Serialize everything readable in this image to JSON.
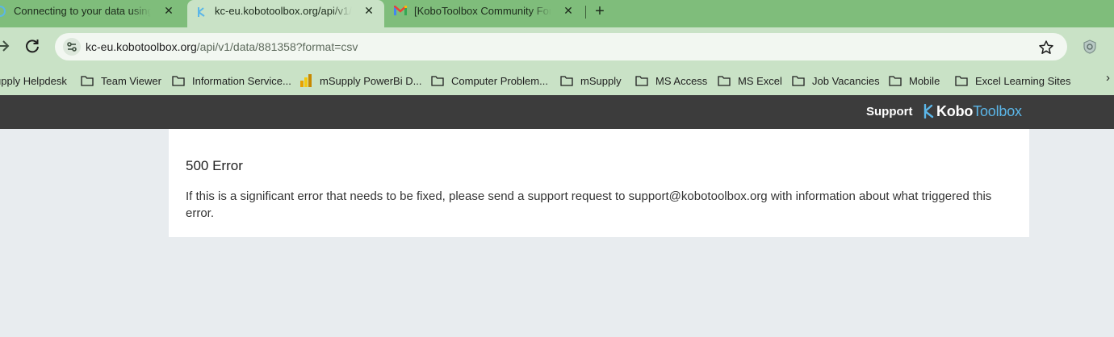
{
  "tabs": [
    {
      "title": "Connecting to your data using",
      "close": "✕"
    },
    {
      "title": "kc-eu.kobotoolbox.org/api/v1/d",
      "close": "✕"
    },
    {
      "title": "[KoboToolbox Community Forum",
      "close": "✕"
    }
  ],
  "new_tab": "+",
  "address_bar": {
    "host": "kc-eu.kobotoolbox.org",
    "path": "/api/v1/data/881358?format=csv"
  },
  "bookmarks": [
    "upply Helpdesk",
    "Team Viewer",
    "Information Service...",
    "mSupply PowerBi D...",
    "Computer Problem...",
    "mSupply",
    "MS Access",
    "MS Excel",
    "Job Vacancies",
    "Mobile",
    "Excel Learning Sites"
  ],
  "header": {
    "support": "Support",
    "logo_bold": "Kobo",
    "logo_light": "Toolbox"
  },
  "error": {
    "title": "500 Error",
    "message": "If this is a significant error that needs to be fixed, please send a support request to support@kobotoolbox.org with information about what triggered this error."
  },
  "colors": {
    "tabstrip": "#7fbd7b",
    "toolbar": "#c9e2c6",
    "kobo_header": "#3c3c3c",
    "kobo_accent": "#5bb6e8",
    "page_bg": "#e8ecef"
  }
}
